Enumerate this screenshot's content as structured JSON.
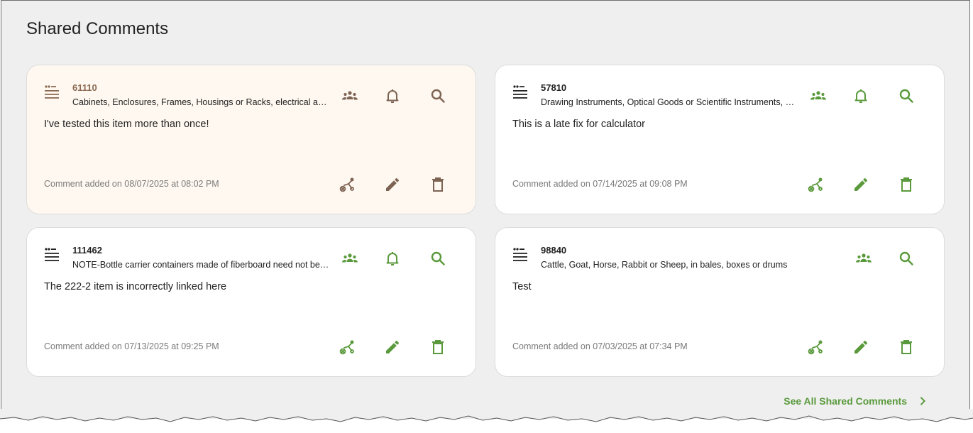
{
  "page": {
    "title": "Shared Comments"
  },
  "colors": {
    "accent": "#5a9a3c",
    "active_accent": "#7d6353",
    "active_bg": "#fff8f0"
  },
  "cards": [
    {
      "id": "61110",
      "description": "Cabinets, Enclosures, Frames, Housings or Racks, electrical apparatus",
      "text": "I've tested this item more than once!",
      "date": "Comment added on 08/07/2025 at 08:02 PM",
      "active": true,
      "icons": [
        "group-icon",
        "bell-icon",
        "search-icon",
        "unlink-icon",
        "pencil-icon",
        "trash-icon"
      ]
    },
    {
      "id": "57810",
      "description": "Drawing Instruments, Optical Goods or Scientific Instruments, apparatus",
      "text": "This is a late fix for calculator",
      "date": "Comment added on 07/14/2025 at 09:08 PM",
      "active": false,
      "icons": [
        "group-icon",
        "bell-icon",
        "search-icon",
        "unlink-icon",
        "pencil-icon",
        "trash-icon"
      ]
    },
    {
      "id": "111462",
      "description": "NOTE-Bottle carrier containers made of fiberboard need not be marked",
      "text": "The 222-2 item is incorrectly linked here",
      "date": "Comment added on 07/13/2025 at 09:25 PM",
      "active": false,
      "icons": [
        "group-icon",
        "bell-icon",
        "search-icon",
        "unlink-icon",
        "pencil-icon",
        "trash-icon"
      ]
    },
    {
      "id": "98840",
      "description": "Cattle, Goat, Horse, Rabbit or Sheep, in bales, boxes or drums",
      "text": "Test",
      "date": "Comment added on 07/03/2025 at 07:34 PM",
      "active": false,
      "icons": [
        "group-icon",
        "search-icon",
        "unlink-icon",
        "pencil-icon",
        "trash-icon"
      ]
    }
  ],
  "footer": {
    "see_all_label": "See All Shared Comments",
    "chevron_icon": "chevron-right-icon"
  }
}
